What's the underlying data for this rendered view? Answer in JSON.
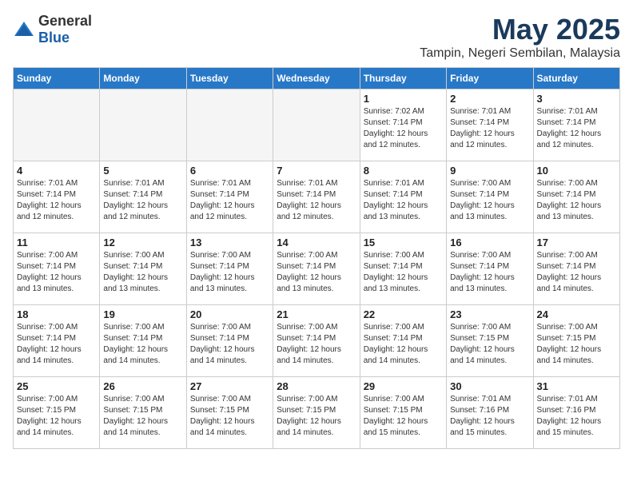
{
  "header": {
    "logo_general": "General",
    "logo_blue": "Blue",
    "month_title": "May 2025",
    "location": "Tampin, Negeri Sembilan, Malaysia"
  },
  "weekdays": [
    "Sunday",
    "Monday",
    "Tuesday",
    "Wednesday",
    "Thursday",
    "Friday",
    "Saturday"
  ],
  "weeks": [
    [
      {
        "day": "",
        "info": ""
      },
      {
        "day": "",
        "info": ""
      },
      {
        "day": "",
        "info": ""
      },
      {
        "day": "",
        "info": ""
      },
      {
        "day": "1",
        "info": "Sunrise: 7:02 AM\nSunset: 7:14 PM\nDaylight: 12 hours\nand 12 minutes."
      },
      {
        "day": "2",
        "info": "Sunrise: 7:01 AM\nSunset: 7:14 PM\nDaylight: 12 hours\nand 12 minutes."
      },
      {
        "day": "3",
        "info": "Sunrise: 7:01 AM\nSunset: 7:14 PM\nDaylight: 12 hours\nand 12 minutes."
      }
    ],
    [
      {
        "day": "4",
        "info": "Sunrise: 7:01 AM\nSunset: 7:14 PM\nDaylight: 12 hours\nand 12 minutes."
      },
      {
        "day": "5",
        "info": "Sunrise: 7:01 AM\nSunset: 7:14 PM\nDaylight: 12 hours\nand 12 minutes."
      },
      {
        "day": "6",
        "info": "Sunrise: 7:01 AM\nSunset: 7:14 PM\nDaylight: 12 hours\nand 12 minutes."
      },
      {
        "day": "7",
        "info": "Sunrise: 7:01 AM\nSunset: 7:14 PM\nDaylight: 12 hours\nand 12 minutes."
      },
      {
        "day": "8",
        "info": "Sunrise: 7:01 AM\nSunset: 7:14 PM\nDaylight: 12 hours\nand 13 minutes."
      },
      {
        "day": "9",
        "info": "Sunrise: 7:00 AM\nSunset: 7:14 PM\nDaylight: 12 hours\nand 13 minutes."
      },
      {
        "day": "10",
        "info": "Sunrise: 7:00 AM\nSunset: 7:14 PM\nDaylight: 12 hours\nand 13 minutes."
      }
    ],
    [
      {
        "day": "11",
        "info": "Sunrise: 7:00 AM\nSunset: 7:14 PM\nDaylight: 12 hours\nand 13 minutes."
      },
      {
        "day": "12",
        "info": "Sunrise: 7:00 AM\nSunset: 7:14 PM\nDaylight: 12 hours\nand 13 minutes."
      },
      {
        "day": "13",
        "info": "Sunrise: 7:00 AM\nSunset: 7:14 PM\nDaylight: 12 hours\nand 13 minutes."
      },
      {
        "day": "14",
        "info": "Sunrise: 7:00 AM\nSunset: 7:14 PM\nDaylight: 12 hours\nand 13 minutes."
      },
      {
        "day": "15",
        "info": "Sunrise: 7:00 AM\nSunset: 7:14 PM\nDaylight: 12 hours\nand 13 minutes."
      },
      {
        "day": "16",
        "info": "Sunrise: 7:00 AM\nSunset: 7:14 PM\nDaylight: 12 hours\nand 13 minutes."
      },
      {
        "day": "17",
        "info": "Sunrise: 7:00 AM\nSunset: 7:14 PM\nDaylight: 12 hours\nand 14 minutes."
      }
    ],
    [
      {
        "day": "18",
        "info": "Sunrise: 7:00 AM\nSunset: 7:14 PM\nDaylight: 12 hours\nand 14 minutes."
      },
      {
        "day": "19",
        "info": "Sunrise: 7:00 AM\nSunset: 7:14 PM\nDaylight: 12 hours\nand 14 minutes."
      },
      {
        "day": "20",
        "info": "Sunrise: 7:00 AM\nSunset: 7:14 PM\nDaylight: 12 hours\nand 14 minutes."
      },
      {
        "day": "21",
        "info": "Sunrise: 7:00 AM\nSunset: 7:14 PM\nDaylight: 12 hours\nand 14 minutes."
      },
      {
        "day": "22",
        "info": "Sunrise: 7:00 AM\nSunset: 7:14 PM\nDaylight: 12 hours\nand 14 minutes."
      },
      {
        "day": "23",
        "info": "Sunrise: 7:00 AM\nSunset: 7:15 PM\nDaylight: 12 hours\nand 14 minutes."
      },
      {
        "day": "24",
        "info": "Sunrise: 7:00 AM\nSunset: 7:15 PM\nDaylight: 12 hours\nand 14 minutes."
      }
    ],
    [
      {
        "day": "25",
        "info": "Sunrise: 7:00 AM\nSunset: 7:15 PM\nDaylight: 12 hours\nand 14 minutes."
      },
      {
        "day": "26",
        "info": "Sunrise: 7:00 AM\nSunset: 7:15 PM\nDaylight: 12 hours\nand 14 minutes."
      },
      {
        "day": "27",
        "info": "Sunrise: 7:00 AM\nSunset: 7:15 PM\nDaylight: 12 hours\nand 14 minutes."
      },
      {
        "day": "28",
        "info": "Sunrise: 7:00 AM\nSunset: 7:15 PM\nDaylight: 12 hours\nand 14 minutes."
      },
      {
        "day": "29",
        "info": "Sunrise: 7:00 AM\nSunset: 7:15 PM\nDaylight: 12 hours\nand 15 minutes."
      },
      {
        "day": "30",
        "info": "Sunrise: 7:01 AM\nSunset: 7:16 PM\nDaylight: 12 hours\nand 15 minutes."
      },
      {
        "day": "31",
        "info": "Sunrise: 7:01 AM\nSunset: 7:16 PM\nDaylight: 12 hours\nand 15 minutes."
      }
    ]
  ]
}
